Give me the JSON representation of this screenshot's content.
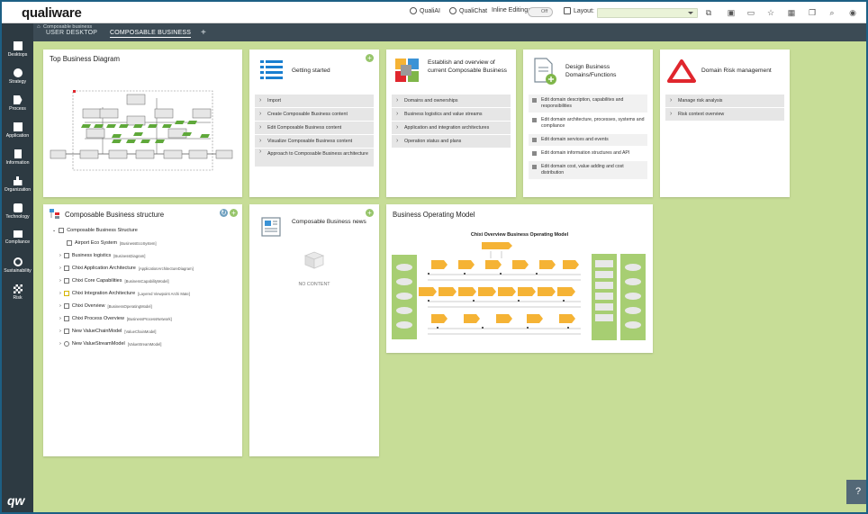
{
  "app": {
    "logo": "qualiware",
    "brand_mark": "qw"
  },
  "topbar": {
    "qualiai": "QualiAI",
    "qualichat": "QualiChat",
    "inline_editing_label": "Inline Editing:",
    "inline_editing_state": "Off",
    "layout_label": "Layout:",
    "layout_value": ""
  },
  "sidebar": {
    "items": [
      {
        "label": "Desktops",
        "icon": "desktops-icon"
      },
      {
        "label": "Strategy",
        "icon": "strategy-icon"
      },
      {
        "label": "Process",
        "icon": "process-icon"
      },
      {
        "label": "Application",
        "icon": "application-icon"
      },
      {
        "label": "Information",
        "icon": "information-icon"
      },
      {
        "label": "Organization",
        "icon": "organization-icon"
      },
      {
        "label": "Technology",
        "icon": "technology-icon"
      },
      {
        "label": "Compliance",
        "icon": "compliance-icon"
      },
      {
        "label": "Sustainability",
        "icon": "sustainability-icon"
      },
      {
        "label": "Risk",
        "icon": "risk-icon"
      }
    ]
  },
  "breadcrumb": "Composable business",
  "tabs": {
    "user_desktop": "USER DESKTOP",
    "composable_business": "COMPOSABLE BUSINESS",
    "add": "+"
  },
  "cards": {
    "top_diagram": {
      "title": "Top Business Diagram"
    },
    "getting_started": {
      "title": "Getting started",
      "items": [
        "Import",
        "Create Composable Business content",
        "Edit Composable Business content",
        "Visualize Composable Business content",
        "Approach to Composable Business architecture"
      ]
    },
    "establish": {
      "title": "Establish and overview of current Composable Business",
      "items": [
        "Domains and ownerships",
        "Business logistics and value streams",
        "Application and integration architectures",
        "Operation status and plans"
      ]
    },
    "design": {
      "title": "Design Business Domains/Functions",
      "items": [
        "Edit domain description, capabilites and responsibilities",
        "Edit domain architecture, processes, systems and compliance",
        "Edit domain services and events",
        "Edit domain information structures and API",
        "Edit domain cost, value adding and cost distribution"
      ]
    },
    "risk": {
      "title": "Domain Risk management",
      "items": [
        "Manage risk analysis",
        "Risk context overview"
      ]
    },
    "structure": {
      "title": "Composable Business structure",
      "root": "Composable Business Structure",
      "items": [
        {
          "name": "Airport Eco System",
          "type": "[BusinessEcoSystem]"
        },
        {
          "name": "Business logistics",
          "type": "[BusinessDiagram]"
        },
        {
          "name": "Chixi Application Architecture",
          "type": "[ApplicationArchitectureDiagram]"
        },
        {
          "name": "Chixi Core Capabilities",
          "type": "[BusinessCapabilityModel]"
        },
        {
          "name": "Chixi Integration Architecture",
          "type": "[Layered Viewpoint Archi Mate]"
        },
        {
          "name": "Chixi Overview",
          "type": "[BusinessOperatingModel]"
        },
        {
          "name": "Chixi Process Overview",
          "type": "[BusinessProcessNetwork]"
        },
        {
          "name": "New ValueChainModel",
          "type": "[ValueChainModel]"
        },
        {
          "name": "New ValueStreamModel",
          "type": "[ValueStreamModel]"
        }
      ]
    },
    "news": {
      "title": "Composable Business news",
      "empty": "NO CONTENT"
    },
    "bom": {
      "title": "Business Operating Model",
      "diagram_title": "Chixi Overview Business Operating Model"
    }
  },
  "colors": {
    "background": "#c7dd97",
    "sidebar": "#2d3a42",
    "tabbar": "#3c4b55",
    "accent_green": "#97c56b",
    "risk_red": "#e0262d",
    "bom_orange": "#f5b335"
  }
}
